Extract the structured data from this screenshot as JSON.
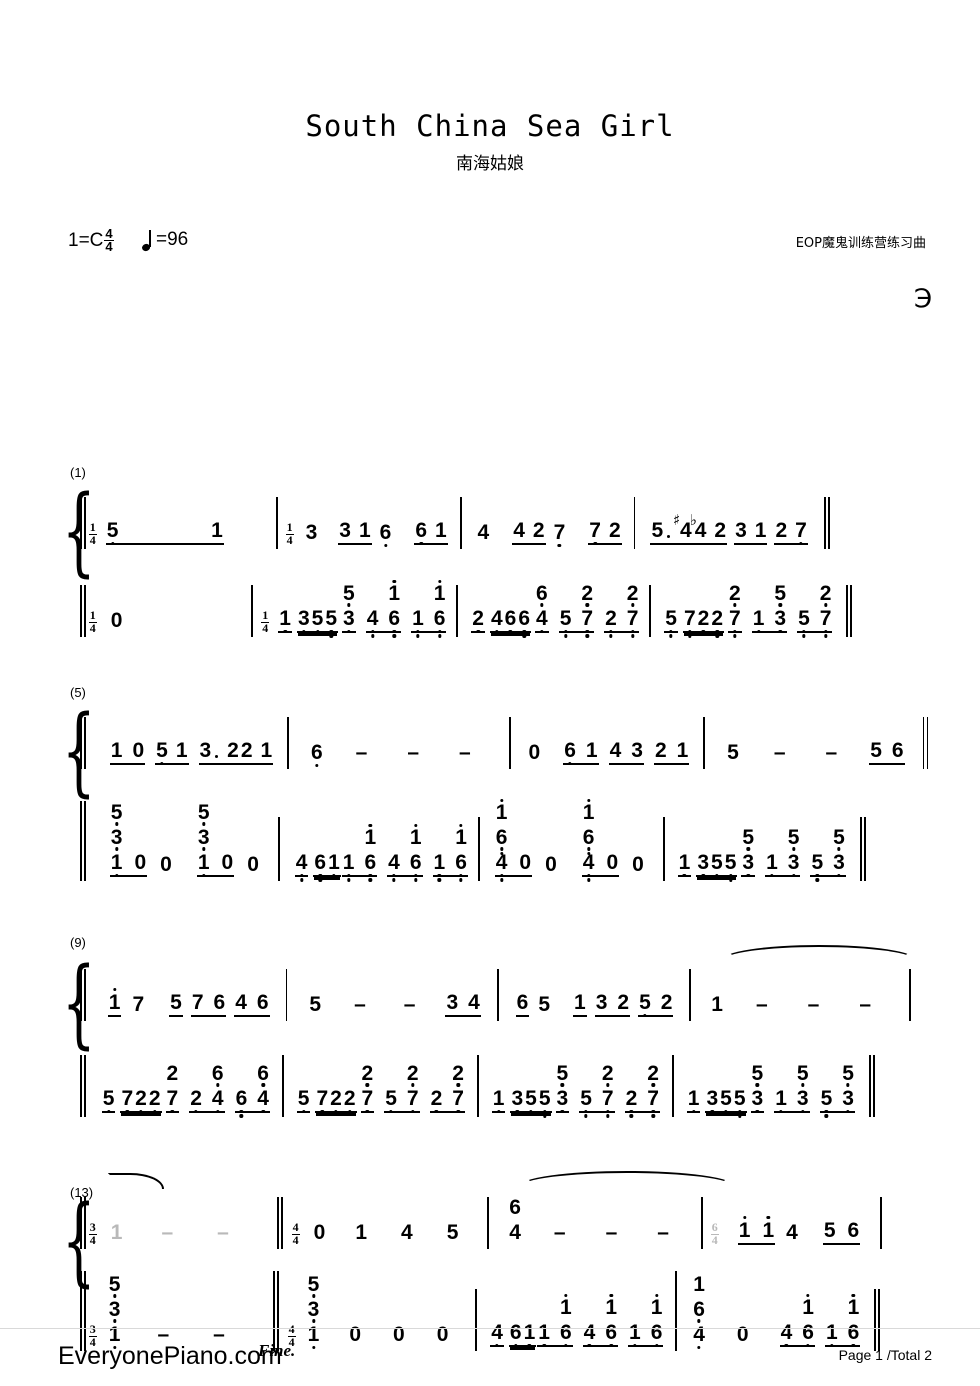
{
  "document": {
    "title": "South China Sea Girl",
    "subtitle": "南海姑娘",
    "key_signature": "1=C",
    "time_signature": {
      "num": "4",
      "den": "4"
    },
    "tempo_label": "=96",
    "tempo_value": "96",
    "arranger_tag": "EOP魔鬼训练营练习曲",
    "segno_symbol": "℈",
    "fine_label": "Fine.",
    "notation_type": "jianpu-numbered-notation",
    "accent_color": "#000000",
    "gray_color": "#b9b9b9"
  },
  "footer": {
    "site": "EveryonePiano.com",
    "page_info": "Page 1 /Total 2"
  },
  "systems": [
    {
      "measure_label": "(1)",
      "treble": {
        "measures": [
          {
            "time_sig": {
              "num": "1",
              "den": "4"
            },
            "tokens": "5. ___ 1"
          },
          {
            "time_sig": {
              "num": "1",
              "den": "4"
            },
            "tokens": "3  3 1 6.  6. 1"
          },
          {
            "tokens": "4  4 2 7.  7. 2"
          },
          {
            "tokens": "5. #4 b4 2  3 1  2 7."
          }
        ]
      },
      "bass": {
        "measures": [
          {
            "time_sig": {
              "num": "1",
              "den": "4"
            },
            "tokens": "0"
          },
          {
            "time_sig": {
              "num": "1",
              "den": "4"
            },
            "tokens": "1. 3.5.5. 3.[5]  4.6.[1]  1.6.[1]"
          },
          {
            "tokens": "2. 4.6.6. 4.[6]  5:7:[2]  2:7:[2]"
          },
          {
            "tokens": "5: 7:2:2: 7:[2]  1.3.[5]  5:7:[2]"
          }
        ]
      }
    },
    {
      "measure_label": "(5)",
      "treble": {
        "measures": [
          {
            "tokens": "1 0  5. 1  3. 2 2 1"
          },
          {
            "tokens": "6.  -  -  -"
          },
          {
            "tokens": "0  6. 1  4 3  2 1"
          },
          {
            "tokens": "5  -  -  5 6"
          }
        ]
      },
      "bass": {
        "measures": [
          {
            "tokens": "[5./3./1.] 0 0   [5./3./1.] 0 0"
          },
          {
            "tokens": "4: 6:1: 1.[1]  6.[1]  4:6:  1.6.[1]"
          },
          {
            "tokens": "[1/6:/4:] 0 0   [1/6:/4:] 0 0"
          },
          {
            "tokens": "1. 3.5.5. 3.[5]  1.3.[5]  5:3.[5]"
          }
        ]
      }
    },
    {
      "measure_label": "(9)",
      "treble": {
        "measures": [
          {
            "tokens": "1' 7  5 7 6 4 6"
          },
          {
            "tokens": "5  -  -  3 4"
          },
          {
            "tokens": "6 5  1 3 2 5. 2"
          },
          {
            "tokens": "1  -  -  -",
            "tie": true
          }
        ]
      },
      "bass": {
        "measures": [
          {
            "tokens": "5. 7.2.2. 7.[2]  2.4.[6]  6:4.[6]"
          },
          {
            "tokens": "5. 7.2.2. 7.[2]  5.7.[2]  2:7:[2]"
          },
          {
            "tokens": "1. 3.5.5. 3.[5]  5.7.[2]  2:7:[2]"
          },
          {
            "tokens": "1. 3.5.5. 3.[5]  1.3.[5]  5:3.[5]"
          }
        ]
      }
    },
    {
      "measure_label": "(13)",
      "treble": {
        "measures": [
          {
            "time_sig": {
              "num": "3",
              "den": "4"
            },
            "tokens": "1 - -",
            "gray": true,
            "tie_end": true
          },
          {
            "time_sig": {
              "num": "4",
              "den": "4"
            },
            "tokens": "0  1  4  5"
          },
          {
            "tokens": "[6/4]  -  -  -",
            "tie": true
          },
          {
            "time_sig": {
              "num": "6",
              "den": "4"
            },
            "time_sig_gray": true,
            "tokens": "1' 1'  4   5 6"
          }
        ]
      },
      "bass": {
        "measures": [
          {
            "time_sig": {
              "num": "3",
              "den": "4"
            },
            "tokens": "[5./3./1.]  -  -"
          },
          {
            "time_sig": {
              "num": "4",
              "den": "4"
            },
            "tokens": "[5./3./1.]  0  0  0"
          },
          {
            "tokens": "4: 6:1: 1.[1]  6.[1]  4:6:  1.6.[1]"
          },
          {
            "tokens": "[1/6./4.]  0   4.6.[1]  1.6.[1]"
          }
        ]
      }
    }
  ]
}
